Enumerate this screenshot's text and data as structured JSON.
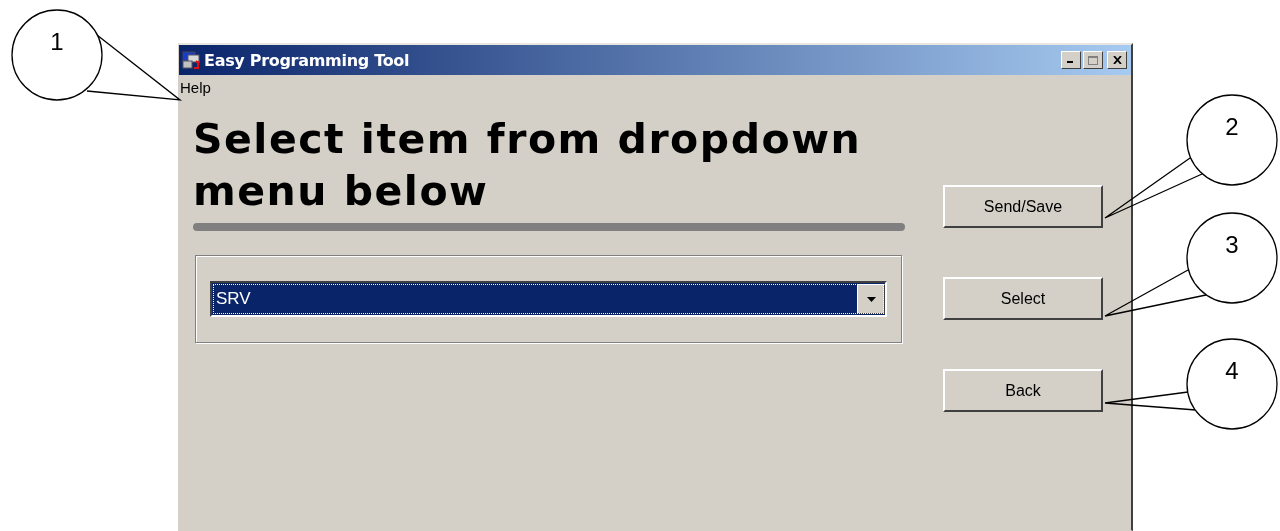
{
  "window": {
    "title": "Easy Programming Tool"
  },
  "menu": [
    "Help"
  ],
  "heading": "Select item from dropdown menu below",
  "dropdown": {
    "value": "SRV"
  },
  "buttons": [
    "Send/Save",
    "Select",
    "Back"
  ],
  "callouts": [
    {
      "number": "1"
    },
    {
      "number": "2"
    },
    {
      "number": "3"
    },
    {
      "number": "4"
    }
  ]
}
